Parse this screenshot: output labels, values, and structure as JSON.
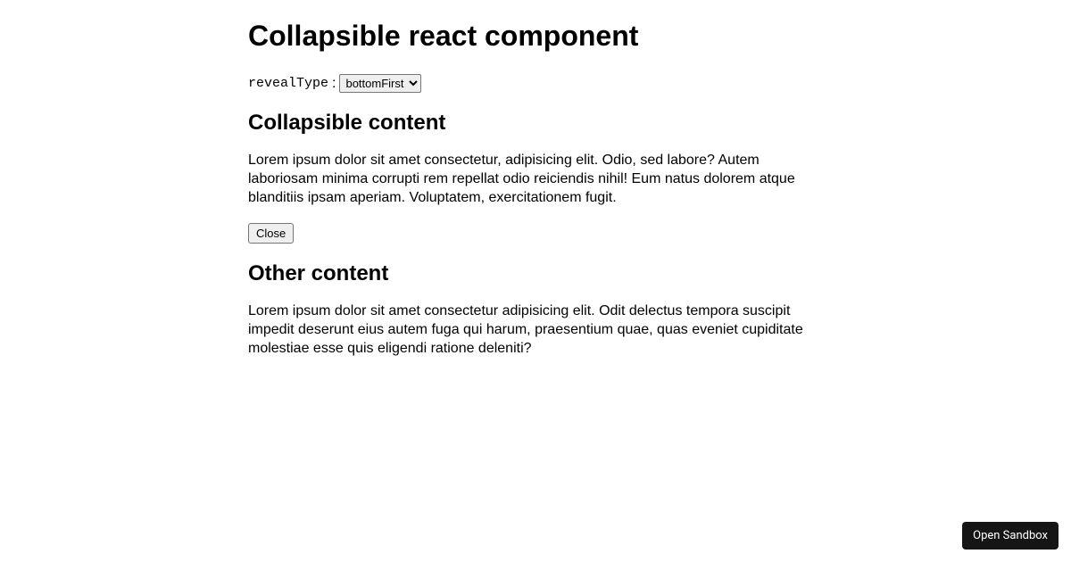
{
  "title": "Collapsible react component",
  "control": {
    "label": "revealType",
    "colon": ":",
    "selected": "bottomFirst"
  },
  "sections": {
    "collapsible": {
      "heading": "Collapsible content",
      "body": "Lorem ipsum dolor sit amet consectetur, adipisicing elit. Odio, sed labore? Autem laboriosam minima corrupti rem repellat odio reiciendis nihil! Eum natus dolorem atque blanditiis ipsam aperiam. Voluptatem, exercitationem fugit.",
      "button": "Close"
    },
    "other": {
      "heading": "Other content",
      "body": "Lorem ipsum dolor sit amet consectetur adipisicing elit. Odit delectus tempora suscipit impedit deserunt eius autem fuga qui harum, praesentium quae, quas eveniet cupiditate molestiae esse quis eligendi ratione deleniti?"
    }
  },
  "sandbox_button": "Open Sandbox"
}
